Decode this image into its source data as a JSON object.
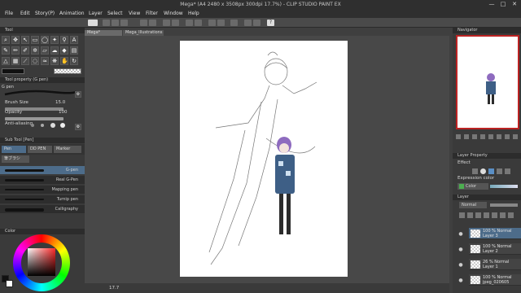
{
  "title_bar": {
    "title": "Mega* (A4 2480 x 3508px 300dpi 17.7%) - CLIP STUDIO PAINT EX",
    "minimize": "—",
    "maximize": "□",
    "close": "✕"
  },
  "menu": [
    "File",
    "Edit",
    "Story(P)",
    "Animation",
    "Layer",
    "Select",
    "View",
    "Filter",
    "Window",
    "Help"
  ],
  "tabs": {
    "canvas_tab_1": "Mega*",
    "canvas_tab_2": "Mega_Illustrations"
  },
  "left_panel": {
    "tool_header": "Tool",
    "tool_property_header": "Tool property (G pen)",
    "tool_name": "G pen",
    "brush_size_label": "Brush Size",
    "brush_size_value": "15.0",
    "opacity_label": "Opacity",
    "opacity_value": "100",
    "anti_aliasing_label": "Anti-aliasing",
    "sub_tool_header": "Sub Tool [Pen]",
    "sub_tool_tabs": [
      "Pen",
      "DD PEN",
      "Marker",
      "筆ブラシ"
    ],
    "brushes": [
      "G-pen",
      "Real G-Pen",
      "Mapping pen",
      "Turnip pen",
      "Calligraphy"
    ],
    "color_header": "Color"
  },
  "status_bar": {
    "zoom": "17.7"
  },
  "right_panel": {
    "navigator_header": "Navigator",
    "layer_property_header": "Layer Property",
    "effect_label": "Effect",
    "expression_color_label": "Expression color",
    "expression_color_value": "Color",
    "layer_header": "Layer",
    "blend_mode": "Normal",
    "layers": [
      {
        "opacity": "100 % Normal",
        "name": "Layer 3",
        "selected": true
      },
      {
        "opacity": "100 % Normal",
        "name": "Layer 2",
        "selected": false
      },
      {
        "opacity": "26 % Normal",
        "name": "Layer 1",
        "selected": false
      },
      {
        "opacity": "100 % Normal",
        "name": "jpeg_020605",
        "selected": false
      }
    ]
  },
  "colors": {
    "primary": "#1a1a1a",
    "secondary": "#ffffff",
    "accent": "#4d6c8a"
  }
}
